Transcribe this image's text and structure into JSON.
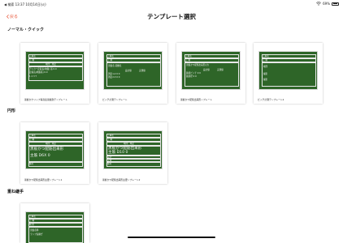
{
  "status": {
    "left_text": "◀ 検索 13:37 10月14日(火)",
    "battery_text": "69%"
  },
  "nav": {
    "back_label": "戻る",
    "title": "テンプレート選択"
  },
  "sections": [
    {
      "label": "ノーマル・クイック",
      "cards": [
        {
          "caption": "黒板かクリップ等直接黒板耐テンプレート",
          "lines": [
            "工事名",
            "工 種",
            "場所：未定",
            "アンカー定着長(地盤) 基 0.0",
            "定着長(地盤基) 0.0",
            "1 2 3 T"
          ]
        },
        {
          "caption": "ビッチ計測テンプレート",
          "lines": [
            "工事名",
            "工 種",
            "黒板名-画像名",
            "設計値",
            "実測値",
            "測定1-2 0 0",
            "測定2-3 0 0"
          ]
        },
        {
          "caption": "黒板かつ配筋出来形ンプレート",
          "lines": [
            "工事名",
            "工 種",
            "黒板かつ配筋出来形(計)",
            "設計値",
            "実測値",
            "鉄筋ビッチ 0 0",
            "鉄筋径 0 0"
          ]
        },
        {
          "caption": "ビッチ計測テンプレート2",
          "lines": [
            "工事名",
            "工 種",
            "場所",
            "撮影",
            "撮影"
          ]
        }
      ]
    },
    {
      "label": "円形",
      "cards": [
        {
          "caption": "黒板かつ配筋出来形主要ンプレート1",
          "lines": [
            "工事名",
            "工 種",
            "場所：未定",
            "黒板かつ配筋出来形",
            "主筋 D6X 0",
            "備考"
          ]
        },
        {
          "caption": "黒板かつ配筋出来形主要ンプレート2",
          "lines": [
            "工事名",
            "工 種",
            "場所：未定",
            "黒板かつ配筋出来形",
            "主筋 D10 0",
            "設計",
            "実測",
            "備考"
          ]
        }
      ]
    },
    {
      "label": "重ね継手",
      "cards": [
        {
          "caption": "",
          "lines": [
            "工事名",
            "工 種",
            "場 所",
            "黒板名称",
            "ラップ長継ぎ"
          ]
        }
      ]
    }
  ]
}
